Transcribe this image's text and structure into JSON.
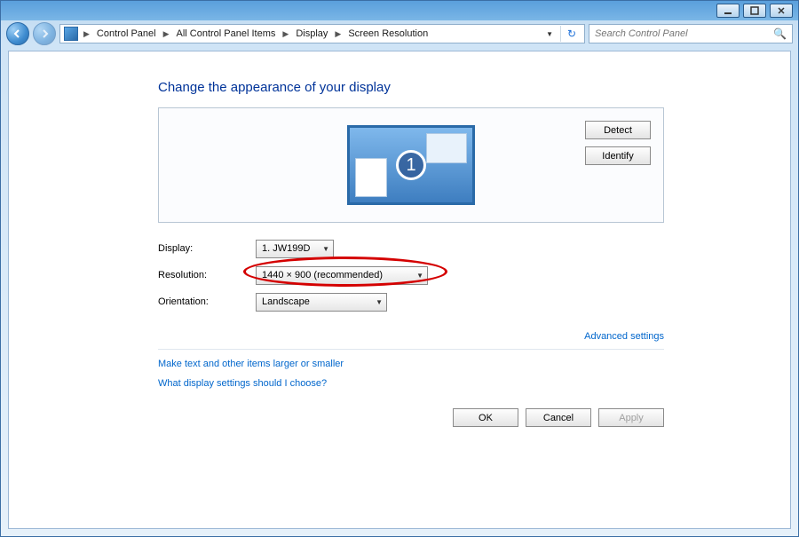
{
  "titlebar": {
    "min": "minimize",
    "max": "maximize",
    "close": "close"
  },
  "breadcrumb": {
    "items": [
      "Control Panel",
      "All Control Panel Items",
      "Display",
      "Screen Resolution"
    ]
  },
  "search": {
    "placeholder": "Search Control Panel"
  },
  "page": {
    "title": "Change the appearance of your display",
    "detect": "Detect",
    "identify": "Identify",
    "monitor_number": "1",
    "display_label": "Display:",
    "display_value": "1. JW199D",
    "resolution_label": "Resolution:",
    "resolution_value": "1440 × 900 (recommended)",
    "orientation_label": "Orientation:",
    "orientation_value": "Landscape",
    "advanced": "Advanced settings",
    "link1": "Make text and other items larger or smaller",
    "link2": "What display settings should I choose?",
    "ok": "OK",
    "cancel": "Cancel",
    "apply": "Apply"
  }
}
